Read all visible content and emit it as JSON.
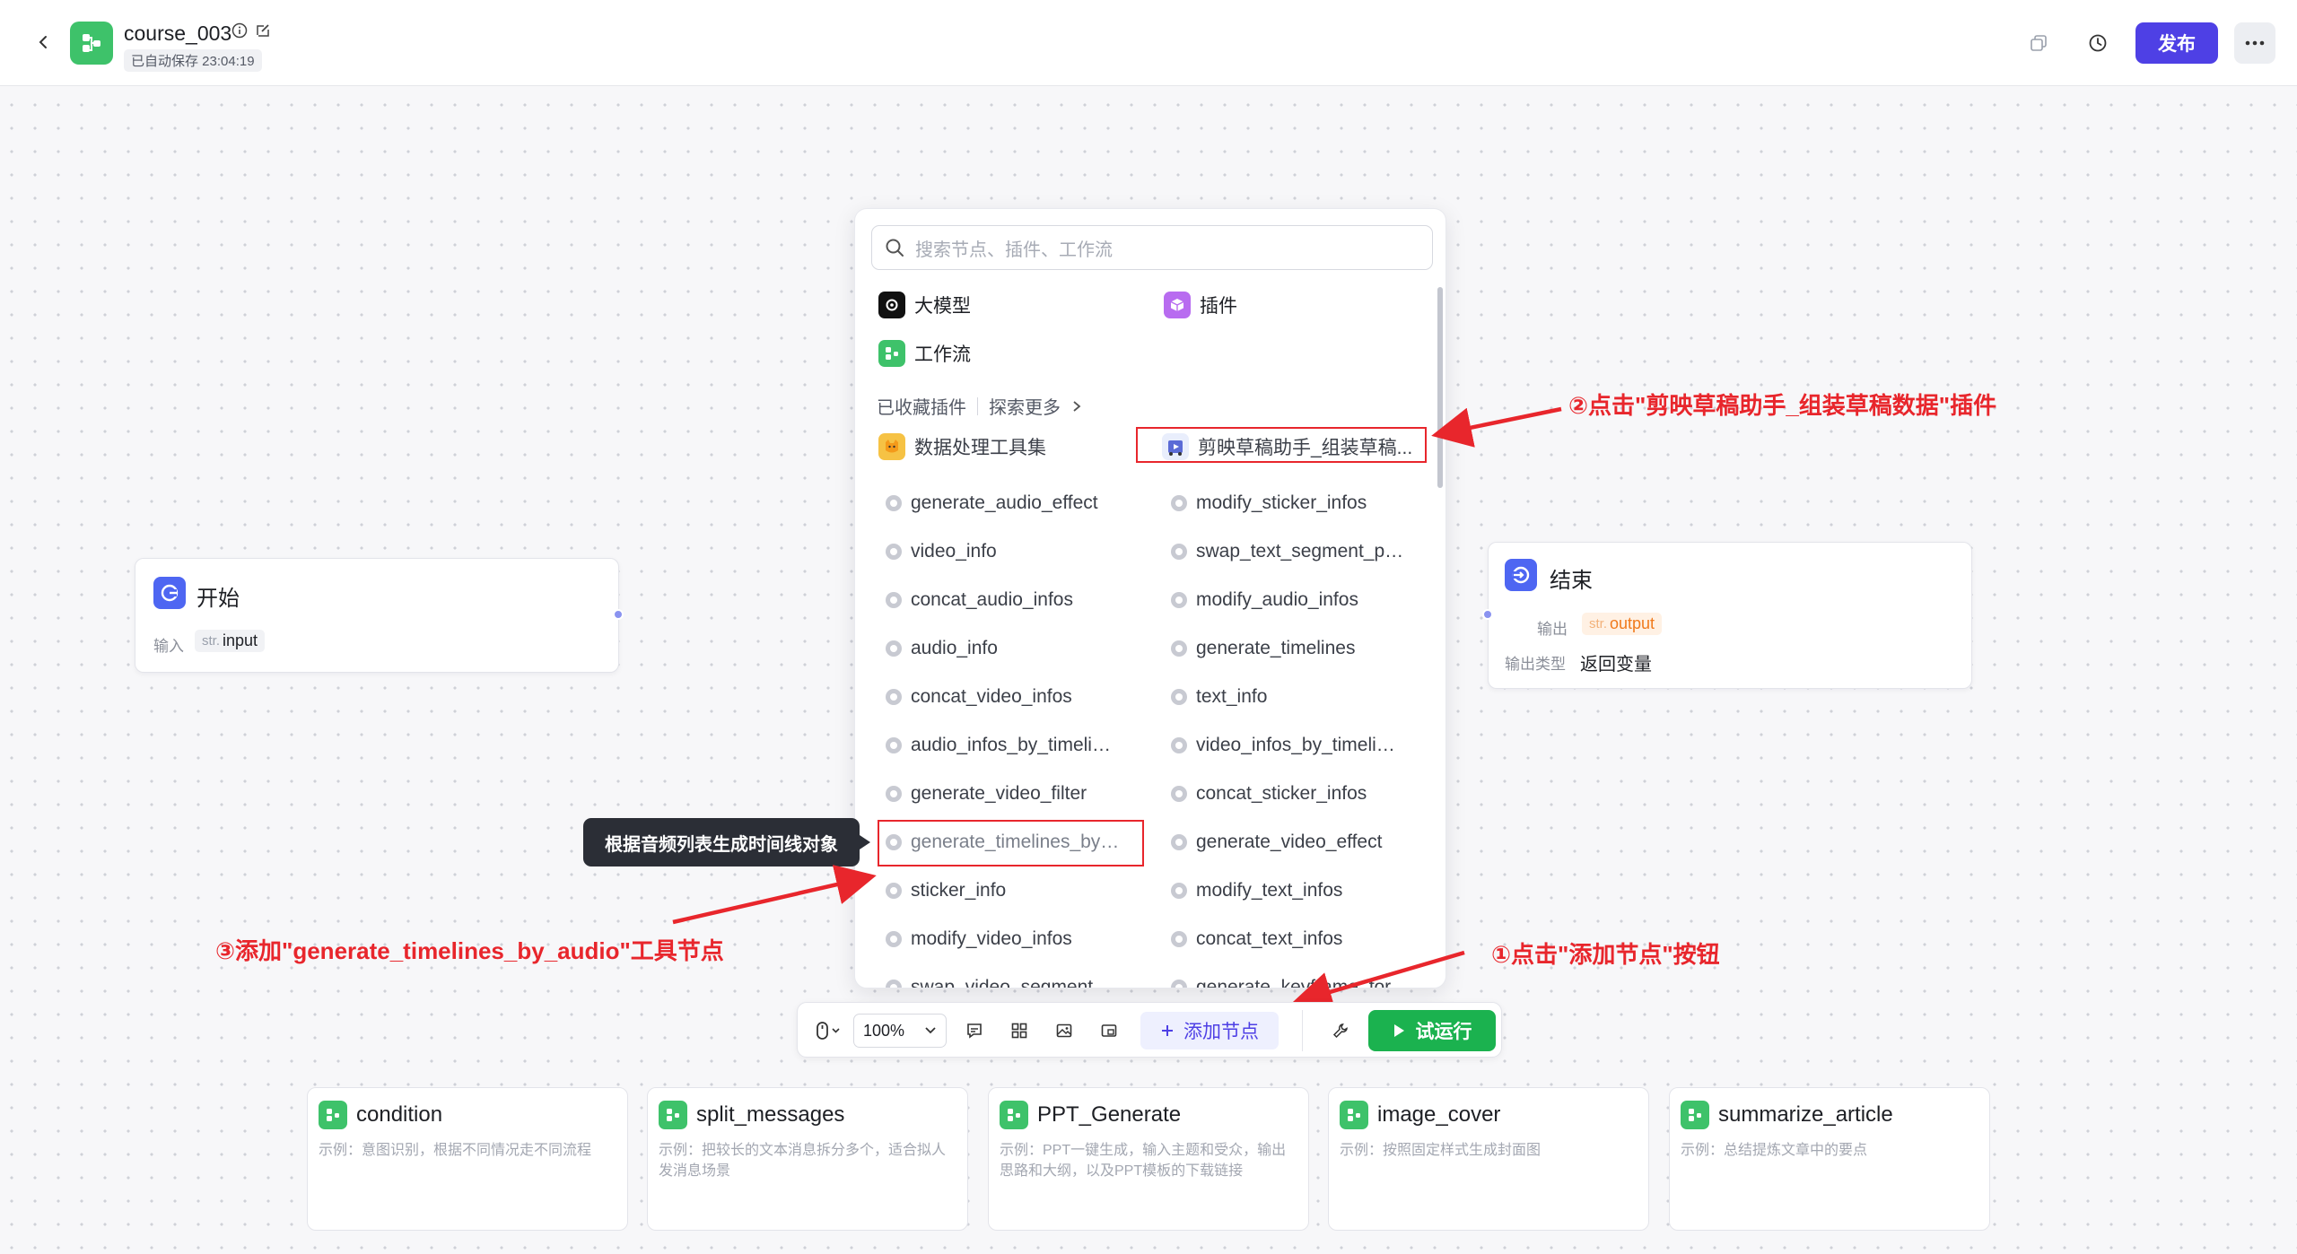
{
  "header": {
    "title": "course_003",
    "autosave": "已自动保存 23:04:19",
    "publish_label": "发布",
    "icons": [
      "copy-icon",
      "history-icon",
      "more-icon"
    ]
  },
  "nodes": {
    "start": {
      "title": "开始",
      "input_label": "输入",
      "var_type": "str.",
      "var_name": "input"
    },
    "end": {
      "title": "结束",
      "output_label": "输出",
      "var_type": "str.",
      "var_name": "output",
      "output_type_label": "输出类型",
      "output_type_value": "返回变量"
    }
  },
  "panel": {
    "search_placeholder": "搜索节点、插件、工作流",
    "categories": {
      "llm": "大模型",
      "plugin": "插件",
      "workflow": "工作流"
    },
    "fav_label": "已收藏插件",
    "explore_label": "探索更多",
    "fav_items": [
      "数据处理工具集",
      "剪映草稿助手_组装草稿..."
    ],
    "tools_left": [
      "generate_audio_effect",
      "video_info",
      "concat_audio_infos",
      "audio_info",
      "concat_video_infos",
      "audio_infos_by_timeli…",
      "generate_video_filter",
      "generate_timelines_by…",
      "sticker_info",
      "modify_video_infos",
      "swap_video_segment…"
    ],
    "tools_right": [
      "modify_sticker_infos",
      "swap_text_segment_p…",
      "modify_audio_infos",
      "generate_timelines",
      "text_info",
      "video_infos_by_timeli…",
      "concat_sticker_infos",
      "generate_video_effect",
      "modify_text_infos",
      "concat_text_infos",
      "generate_keyframe_for…"
    ]
  },
  "tooltip": "根据音频列表生成时间线对象",
  "annotations": {
    "step1": "①点击\"添加节点\"按钮",
    "step2": "②点击\"剪映草稿助手_组装草稿数据\"插件",
    "step3": "③添加\"generate_timelines_by_audio\"工具节点"
  },
  "toolbar": {
    "zoom": "100%",
    "add_node_label": "添加节点",
    "run_label": "试运行"
  },
  "templates": [
    {
      "title": "condition",
      "desc": "示例：意图识别，根据不同情况走不同流程"
    },
    {
      "title": "split_messages",
      "desc": "示例：把较长的文本消息拆分多个，适合拟人发消息场景"
    },
    {
      "title": "PPT_Generate",
      "desc": "示例：PPT一键生成，输入主题和受众，输出思路和大纲，以及PPT模板的下载链接"
    },
    {
      "title": "image_cover",
      "desc": "示例：按照固定样式生成封面图"
    },
    {
      "title": "summarize_article",
      "desc": "示例：总结提炼文章中的要点"
    }
  ],
  "colors": {
    "accent": "#4e40e5",
    "run_green": "#1bb24f",
    "annotation_red": "#e8262c",
    "workflow_green": "#3ec26a"
  }
}
